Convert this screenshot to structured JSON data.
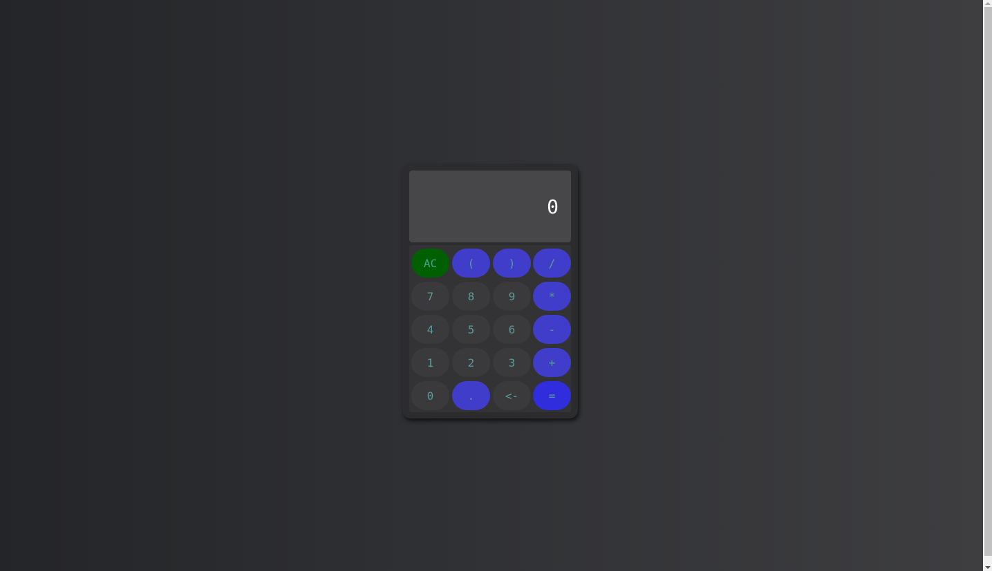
{
  "display": {
    "value": "0"
  },
  "keys": [
    {
      "label": "AC",
      "kind": "clear"
    },
    {
      "label": "(",
      "kind": "op"
    },
    {
      "label": ")",
      "kind": "op"
    },
    {
      "label": "/",
      "kind": "op"
    },
    {
      "label": "7",
      "kind": "num"
    },
    {
      "label": "8",
      "kind": "num"
    },
    {
      "label": "9",
      "kind": "num"
    },
    {
      "label": "*",
      "kind": "op"
    },
    {
      "label": "4",
      "kind": "num"
    },
    {
      "label": "5",
      "kind": "num"
    },
    {
      "label": "6",
      "kind": "num"
    },
    {
      "label": "-",
      "kind": "op"
    },
    {
      "label": "1",
      "kind": "num"
    },
    {
      "label": "2",
      "kind": "num"
    },
    {
      "label": "3",
      "kind": "num"
    },
    {
      "label": "+",
      "kind": "op"
    },
    {
      "label": "0",
      "kind": "num"
    },
    {
      "label": ".",
      "kind": "op"
    },
    {
      "label": "<-",
      "kind": "num"
    },
    {
      "label": "=",
      "kind": "equals"
    }
  ],
  "colors": {
    "operator": "#3f3dc9",
    "equals": "#2f2ddc",
    "clear": "#005f00",
    "number": "#3a3a3c"
  }
}
